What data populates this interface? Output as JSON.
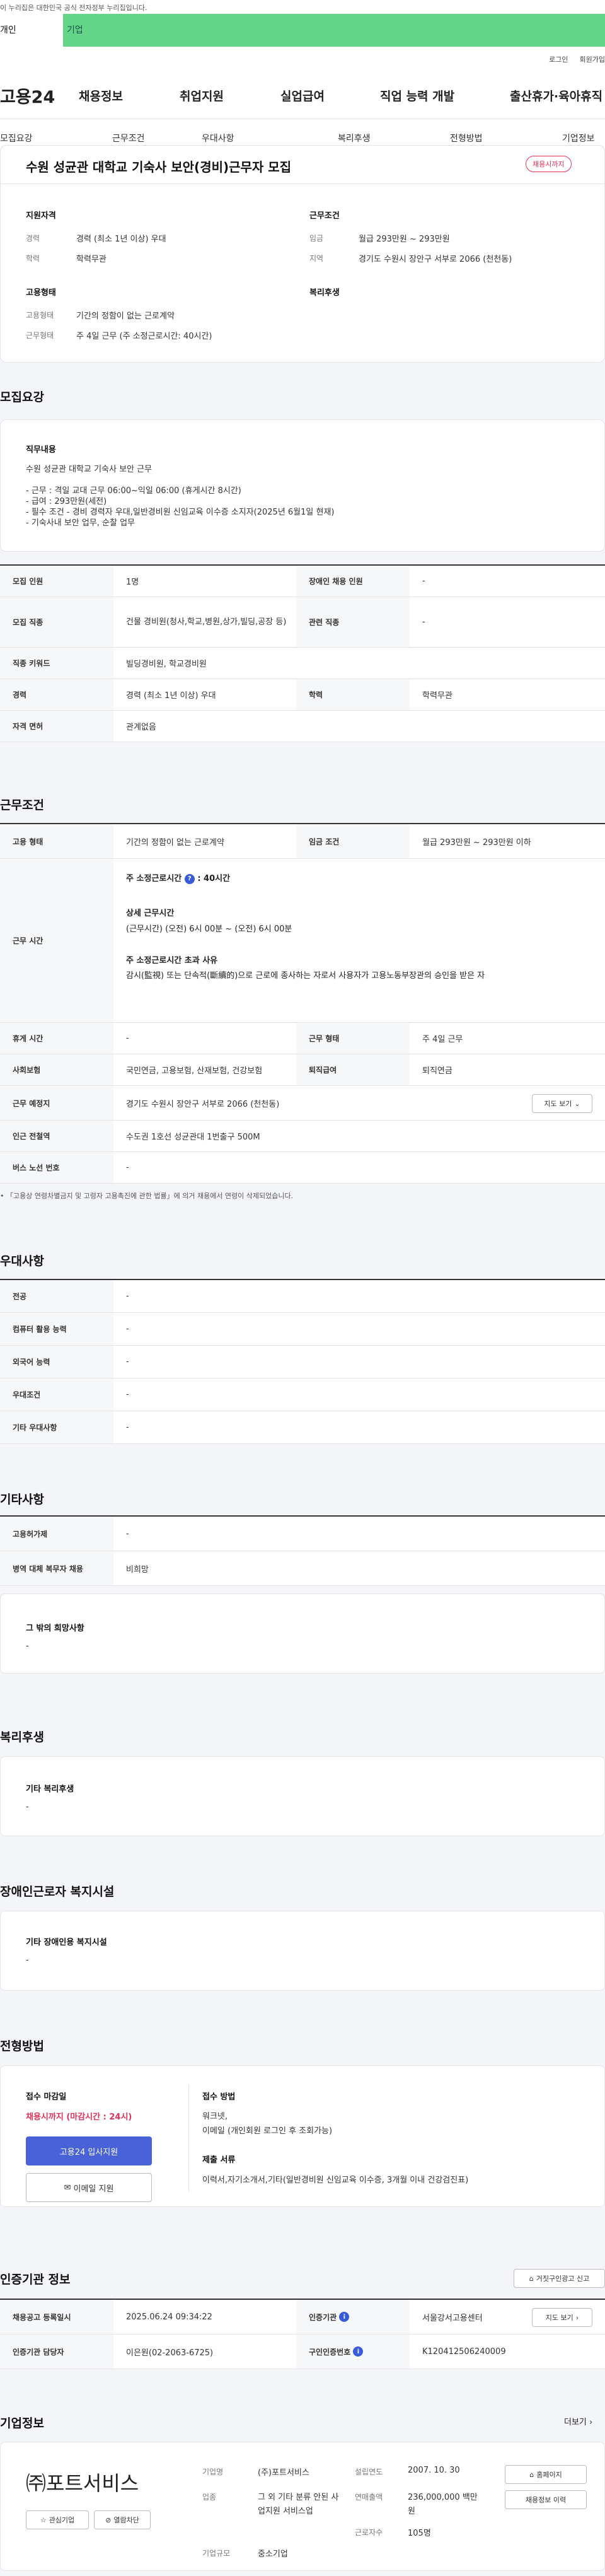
{
  "gov_banner": "이 누리집은 대한민국 공식 전자정부 누리집입니다.",
  "user_tabs": {
    "individual": "개인",
    "enterprise": "기업"
  },
  "top_links": {
    "login": "로그인",
    "join": "회원가입"
  },
  "logo": "고용24",
  "gnb": [
    "채용정보",
    "취업지원",
    "실업급여",
    "직업 능력 개발",
    "출산휴가·육아휴직"
  ],
  "subnav": [
    "모집요강",
    "근무조건",
    "우대사항",
    "복리후생",
    "전형방법",
    "기업정보"
  ],
  "summary": {
    "title": "수원 성균관 대학교 기숙사 보안(경비)근무자 모집",
    "badge": "채용시까지",
    "qual_title": "지원자격",
    "career_label": "경력",
    "career": "경력 (최소 1년 이상) 우대",
    "edu_label": "학력",
    "edu": "학력무관",
    "cond_title": "근무조건",
    "wage_label": "임금",
    "wage": "월급 293만원 ~ 293만원",
    "area_label": "지역",
    "area": "경기도 수원시 장안구 서부로 2066 (천천동)",
    "emp_title": "고용형태",
    "type_label": "고용형태",
    "type": "기간의 정함이 없는 근로계약",
    "work_label": "근무형태",
    "work": "주 4일 근무 (주 소정근로시간: 40시간)",
    "welfare_title": "복리후생"
  },
  "recruit": {
    "section": "모집요강",
    "duty_title": "직무내용",
    "duty_lines": [
      "수원 성균관 대학교 기숙사 보안 근무",
      "",
      "- 근무 : 격일 교대 근무 06:00~익일 06:00 (휴게시간 8시간)",
      "- 급여 : 293만원(세전)",
      "- 필수 조건 - 경비 경력자 우대,일반경비원 신임교육 이수증 소지자(2025년 6월1일 현재)",
      "- 기숙사내 보안 업무, 순찰 업무"
    ],
    "rows": [
      {
        "l1": "모집 인원",
        "v1": "1명",
        "l2": "장애인 채용 인원",
        "v2": "-"
      },
      {
        "l1": "모집 직종",
        "v1": "건물 경비원(청사,학교,병원,상가,빌딩,공장 등)",
        "l2": "관련 직종",
        "v2": "-"
      },
      {
        "l1": "직종 키워드",
        "v1": "빌딩경비원, 학교경비원"
      },
      {
        "l1": "경력",
        "v1": "경력 (최소 1년 이상) 우대",
        "l2": "학력",
        "v2": "학력무관"
      },
      {
        "l1": "자격 면허",
        "v1": "관계없음"
      }
    ]
  },
  "condition": {
    "section": "근무조건",
    "r1": {
      "l1": "고용 형태",
      "v1": "기간의 정함이 없는 근로계약",
      "l2": "임금 조건",
      "v2": "월급 293만원 ~ 293만원 이하"
    },
    "worktime_label": "근무 시간",
    "wt_weekly": "주 소정근로시간",
    "wt_weekly_val": ": 40시간",
    "wt_icon": "?",
    "wt_detail_title": "상세 근무시간",
    "wt_detail": "(근무시간) (오전) 6시 00분 ~ (오전) 6시 00분",
    "wt_exceed_title": "주 소정근로시간 초과 사유",
    "wt_exceed": "감시(監視) 또는 단속적(斷續的)으로 근로에 종사하는 자로서 사용자가 고용노동부장관의 승인을 받은 자",
    "r3": {
      "l1": "휴게 시간",
      "v1": "-",
      "l2": "근무 형태",
      "v2": "주 4일 근무"
    },
    "r4": {
      "l1": "사회보험",
      "v1": "국민연금, 고용보험, 산재보험, 건강보험",
      "l2": "퇴직급여",
      "v2": "퇴직연금"
    },
    "r5": {
      "l1": "근무 예정지",
      "v1": "경기도 수원시 장안구 서부로 2066 (천천동)",
      "btn": "지도 보기"
    },
    "r6": {
      "l1": "인근 전철역",
      "v1": "수도권 1호선 성균관대 1번출구 500M"
    },
    "r7": {
      "l1": "버스 노선 번호",
      "v1": "-"
    },
    "note": "• 「고용상 연령차별금지 및 고령자 고용촉진에 관한 법률」에 의거 채용에서 연령이 삭제되었습니다."
  },
  "preference": {
    "section": "우대사항",
    "rows": [
      {
        "l": "전공",
        "v": "-"
      },
      {
        "l": "컴퓨터 활용 능력",
        "v": "-"
      },
      {
        "l": "외국어 능력",
        "v": "-"
      },
      {
        "l": "우대조건",
        "v": "-"
      },
      {
        "l": "기타 우대사항",
        "v": "-"
      }
    ]
  },
  "etc": {
    "section": "기타사항",
    "rows": [
      {
        "l": "고용허가제",
        "v": "-"
      },
      {
        "l": "병역 대체 복무자 채용",
        "v": "비희망"
      }
    ],
    "other_title": "그 밖의 희망사항",
    "other": "-"
  },
  "welfare": {
    "section": "복리후생",
    "title": "기타 복리후생",
    "value": "-"
  },
  "disability": {
    "section": "장애인근로자 복지시설",
    "title": "기타 장애인용 복지시설",
    "value": "-"
  },
  "selection": {
    "section": "전형방법",
    "deadline_title": "접수 마감일",
    "deadline": "채용시까지 (마감시간 : 24시)",
    "apply_btn": "고용24 입사지원",
    "email_btn": "이메일 지원",
    "method_title": "접수 방법",
    "method_lines": [
      "워크넷,",
      "이메일 (개인회원 로그인 후 조회가능)"
    ],
    "docs_title": "제출 서류",
    "docs": "이력서,자기소개서,기타(일반경비원 신임교육 이수증, 3개월 이내 건강검진표)"
  },
  "agency": {
    "section": "인증기관 정보",
    "report_btn": "거짓구인광고 신고",
    "r1": {
      "l1": "채용공고 등록일시",
      "v1": "2025.06.24 09:34:22",
      "l2": "인증기관",
      "v2": "서울강서고용센터",
      "btn": "지도 보기"
    },
    "r2": {
      "l1": "인증기관 담당자",
      "v1": "이은원(02-2063-6725)",
      "l2": "구인인증번호",
      "v2": "K120412506240009"
    }
  },
  "company": {
    "section": "기업정보",
    "more": "더보기",
    "name": "㈜포트서비스",
    "fav_btn": "관심기업",
    "block_btn": "열람차단",
    "f": [
      {
        "l": "기업명",
        "v": "(주)포트서비스"
      },
      {
        "l": "업종",
        "v": "그 외 기타 분류 안된 사업지원 서비스업"
      },
      {
        "l": "기업규모",
        "v": "중소기업"
      }
    ],
    "g": [
      {
        "l": "설립연도",
        "v": "2007. 10. 30"
      },
      {
        "l": "연매출액",
        "v": "236,000,000 백만원"
      },
      {
        "l": "근로자수",
        "v": "105명"
      }
    ],
    "home_btn": "홈페이지",
    "list_btn": "채용정보 이력"
  }
}
